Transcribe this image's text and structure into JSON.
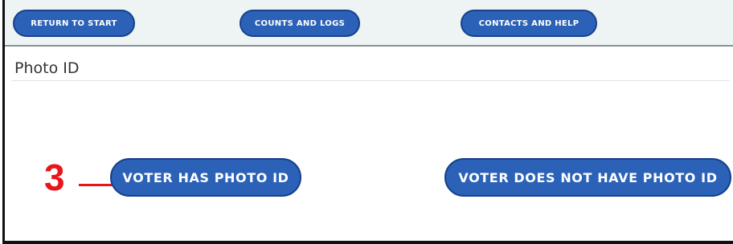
{
  "nav": {
    "return_label": "RETURN TO START",
    "counts_label": "COUNTS AND LOGS",
    "contacts_label": "CONTACTS AND HELP"
  },
  "section": {
    "title": "Photo ID"
  },
  "actions": {
    "has_photo_label": "VOTER HAS PHOTO ID",
    "no_photo_label": "VOTER DOES NOT HAVE PHOTO ID"
  },
  "annotation": {
    "step_number": "3"
  },
  "colors": {
    "button_fill": "#2b62b8",
    "button_border": "#17408a",
    "annotation": "#e8161b",
    "topbar_bg": "#eef3f4"
  }
}
